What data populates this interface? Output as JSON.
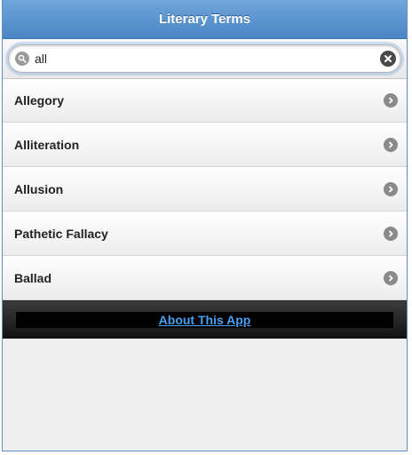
{
  "header": {
    "title": "Literary Terms"
  },
  "search": {
    "value": "all"
  },
  "list": {
    "items": [
      {
        "label": "Allegory"
      },
      {
        "label": "Alliteration"
      },
      {
        "label": "Allusion"
      },
      {
        "label": "Pathetic Fallacy"
      },
      {
        "label": "Ballad"
      }
    ]
  },
  "footer": {
    "link_label": "About This App"
  },
  "icons": {
    "search": "search-icon",
    "clear": "clear-icon",
    "arrow": "chevron-right-icon"
  },
  "colors": {
    "header": "#4a86c5",
    "footer": "#111111",
    "link": "#4aa0f0"
  }
}
